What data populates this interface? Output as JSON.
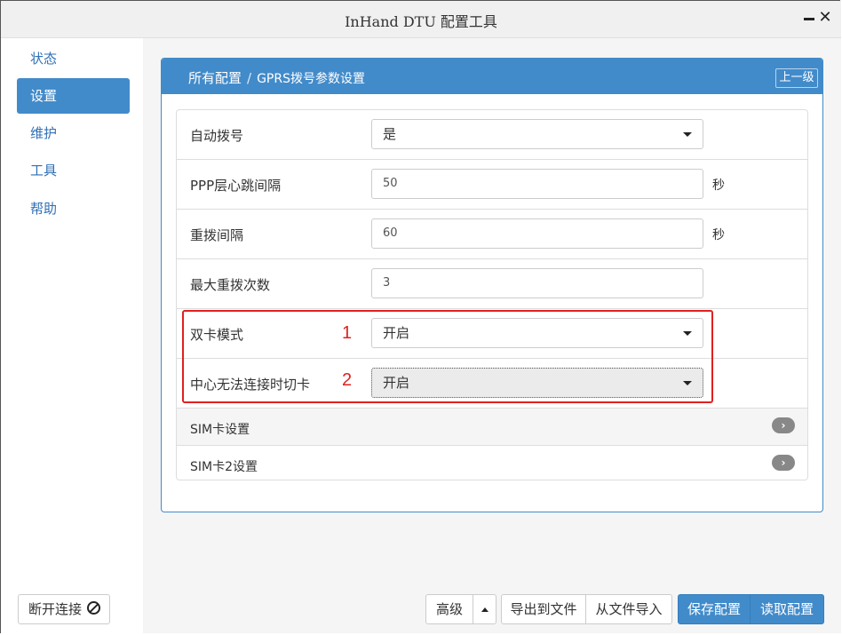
{
  "window": {
    "title": "InHand DTU 配置工具"
  },
  "sidebar": {
    "items": [
      {
        "label": "状态",
        "active": false
      },
      {
        "label": "设置",
        "active": true
      },
      {
        "label": "维护",
        "active": false
      },
      {
        "label": "工具",
        "active": false
      },
      {
        "label": "帮助",
        "active": false
      }
    ]
  },
  "panel": {
    "breadcrumb": {
      "root": "所有配置",
      "separator": "/",
      "current": "GPRS拨号参数设置"
    },
    "up_button": "上一级"
  },
  "form": {
    "rows": [
      {
        "label": "自动拨号",
        "type": "select",
        "value": "是",
        "unit": ""
      },
      {
        "label": "PPP层心跳间隔",
        "type": "input",
        "value": "50",
        "unit": "秒"
      },
      {
        "label": "重拨间隔",
        "type": "input",
        "value": "60",
        "unit": "秒"
      },
      {
        "label": "最大重拨次数",
        "type": "input",
        "value": "3",
        "unit": ""
      },
      {
        "label": "双卡模式",
        "type": "select",
        "value": "开启",
        "unit": ""
      },
      {
        "label": "中心无法连接时切卡",
        "type": "select",
        "value": "开启",
        "unit": ""
      }
    ],
    "sections": [
      {
        "label": "SIM卡设置"
      },
      {
        "label": "SIM卡2设置"
      }
    ]
  },
  "annotations": {
    "marker_1": "1",
    "marker_2": "2",
    "color": "#e02020"
  },
  "footer": {
    "disconnect": "断开连接",
    "advanced": "高级",
    "export": "导出到文件",
    "import": "从文件导入",
    "save": "保存配置",
    "read": "读取配置"
  },
  "colors": {
    "accent": "#428bca",
    "highlight": "#e02020"
  }
}
